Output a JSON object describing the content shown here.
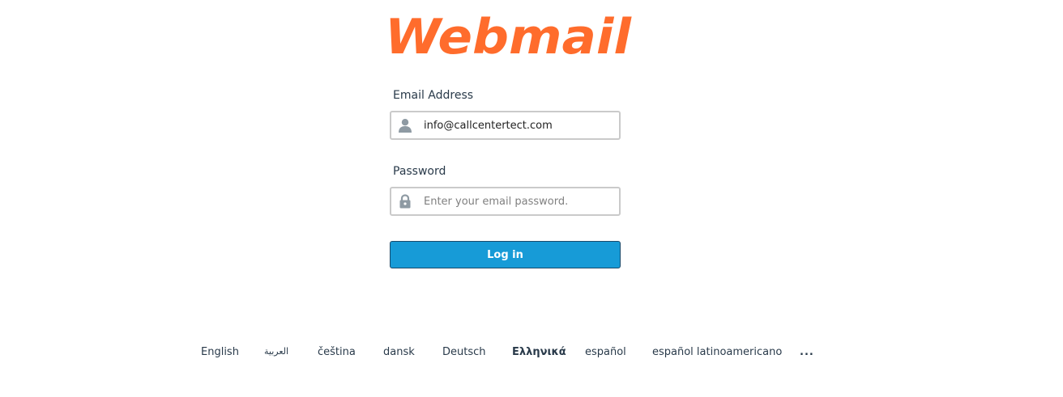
{
  "logo": {
    "text": "Webmail",
    "color": "#ff6c2c"
  },
  "form": {
    "email_label": "Email Address",
    "email_value": "info@callcentertect.com",
    "password_label": "Password",
    "password_placeholder": "Enter your email password.",
    "login_label": "Log in",
    "login_color": "#179bd7"
  },
  "languages": {
    "items": [
      "English",
      "العربية",
      "čeština",
      "dansk",
      "Deutsch",
      "Ελληνικά",
      "español",
      "español latinoamericano"
    ],
    "more_label": "..."
  },
  "icons": {
    "email": "user-icon",
    "password": "lock-icon"
  }
}
